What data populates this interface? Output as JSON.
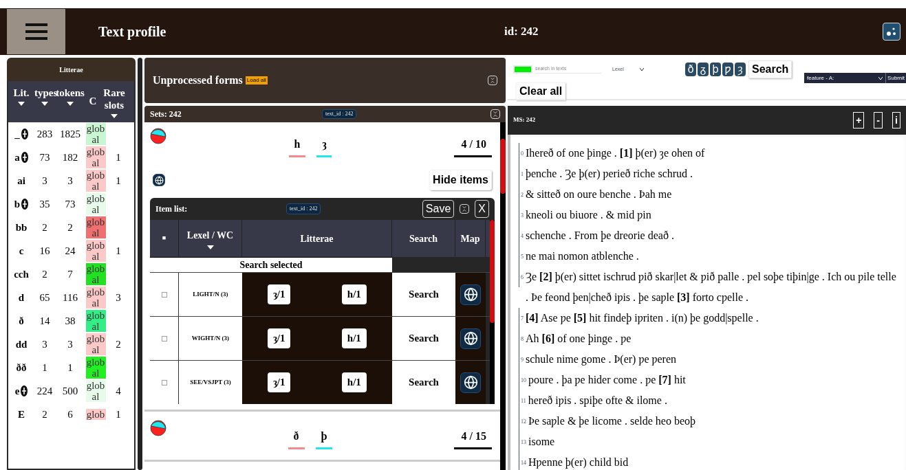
{
  "header": {
    "title": "Text profile",
    "id_label": "id: 242"
  },
  "litterae": {
    "title": "Litterae",
    "columns": [
      {
        "label": "Lit.",
        "sortable": true
      },
      {
        "label": "types",
        "sortable": true
      },
      {
        "label": "tokens",
        "sortable": true
      },
      {
        "label": "C",
        "sortable": false
      },
      {
        "label": "Rare slots",
        "sortable": true
      }
    ],
    "rows": [
      {
        "lit": "_",
        "expandable": true,
        "types": "283",
        "tokens": "1825",
        "c": "global",
        "color": "#c8f5d2"
      },
      {
        "lit": "a",
        "expandable": true,
        "types": "73",
        "tokens": "182",
        "c": "global",
        "color": "#fcc8c8",
        "rare": "1"
      },
      {
        "lit": "ai",
        "expandable": false,
        "types": "3",
        "tokens": "3",
        "c": "global",
        "color": "#fcc8c8",
        "rare": "1"
      },
      {
        "lit": "b",
        "expandable": true,
        "types": "35",
        "tokens": "73",
        "c": "global",
        "color": "#e8fbea"
      },
      {
        "lit": "bb",
        "expandable": false,
        "types": "2",
        "tokens": "2",
        "c": "global",
        "color": "#f07070"
      },
      {
        "lit": "c",
        "expandable": false,
        "types": "16",
        "tokens": "24",
        "c": "global",
        "color": "#fcc8c8",
        "rare": "1"
      },
      {
        "lit": "cch",
        "expandable": false,
        "types": "2",
        "tokens": "7",
        "c": "global",
        "color": "#22e022"
      },
      {
        "lit": "d",
        "expandable": false,
        "types": "65",
        "tokens": "116",
        "c": "global",
        "color": "#fcc8c8",
        "rare": "3"
      },
      {
        "lit": "ð",
        "expandable": false,
        "types": "14",
        "tokens": "38",
        "c": "global",
        "color": "#33ee88"
      },
      {
        "lit": "dd",
        "expandable": false,
        "types": "3",
        "tokens": "3",
        "c": "global",
        "color": "#fcc8c8",
        "rare": "2"
      },
      {
        "lit": "ðð",
        "expandable": false,
        "types": "1",
        "tokens": "1",
        "c": "global",
        "color": "#22ee22"
      },
      {
        "lit": "e",
        "expandable": true,
        "types": "224",
        "tokens": "500",
        "c": "global",
        "color": "#e8fbea",
        "rare": "4"
      },
      {
        "lit": "E",
        "expandable": false,
        "types": "2",
        "tokens": "6",
        "c": "glob",
        "color": "#fcc8c8",
        "rare": "1"
      }
    ]
  },
  "unprocessed": {
    "title": "Unprocessed forms",
    "load_button": "Load all"
  },
  "sets": {
    "title": "Sets: 242",
    "badge": "text_id : 242",
    "items": [
      {
        "letters": [
          {
            "char": "h",
            "color": "#f28b8b"
          },
          {
            "char": "ȝ",
            "color": "#22e5ee"
          }
        ],
        "count": "4 / 10",
        "hide_button": "Hide items",
        "item_list": {
          "title": "Item list:",
          "badge": "text_id : 242",
          "save": "Save",
          "close": "X",
          "columns": [
            {
              "label": "■",
              "sortable": false
            },
            {
              "label": "Lexel / WC",
              "sortable": true
            },
            {
              "label": "Litterae",
              "sortable": false
            },
            {
              "label": "Search",
              "sortable": false
            },
            {
              "label": "Map",
              "sortable": false
            }
          ],
          "search_selected": "Search selected",
          "rows": [
            {
              "lexel": "LIGHT/N (3)",
              "checked": false,
              "litterae": [
                "ȝ/1",
                "h/1"
              ],
              "search": "Search"
            },
            {
              "lexel": "WIGHT/N (3)",
              "checked": false,
              "litterae": [
                "ȝ/1",
                "h/1"
              ],
              "search": "Search"
            },
            {
              "lexel": "SEE/VSJPT (3)",
              "checked": false,
              "litterae": [
                "ȝ/1",
                "h/1"
              ],
              "search": "Search"
            }
          ]
        }
      },
      {
        "letters": [
          {
            "char": "ð",
            "color": "#f28b8b"
          },
          {
            "char": "þ",
            "color": "#22e5ee"
          }
        ],
        "count": "4 / 15"
      }
    ]
  },
  "search_bar": {
    "color": "#00ee00",
    "placeholder": "search in texts",
    "select": "Lexel",
    "chars": [
      "ð",
      "ᵹ",
      "þ",
      "ƿ",
      "ȝ"
    ],
    "search_button": "Search",
    "clear_button": "Clear all",
    "feature_select": "feature - A:",
    "submit": "Submit"
  },
  "ms": {
    "title": "MS: 242",
    "buttons": [
      "+",
      "-",
      "i"
    ],
    "lines": [
      {
        "num": "0",
        "text": "Ihereð of one þinge . **[1]** þ(er) ȝe ohen of"
      },
      {
        "num": "1",
        "text": "þenche . Ȝe þ(er) ƿerieð riche schrud ."
      },
      {
        "num": "2",
        "text": "& sitteð on oure benche . Þah me"
      },
      {
        "num": "3",
        "text": "kneoli ou biuore . & mid ƿin"
      },
      {
        "num": "4",
        "text": "schenche . From þe dreorie deað ."
      },
      {
        "num": "5",
        "text": "ne mai nomon atblenche ."
      },
      {
        "num": "6",
        "text": "Ȝe **[2]** þ(er) sittet ischrud ƿið skar|let & ƿið palle . ƿel soþe tiþin|ge . Ich ou ƿile telle . Þe feond þen|cheð iƿis . þe saƿle **[3]** forto cƿelle ."
      },
      {
        "num": "7",
        "text": "**[4]** Ase ƿe **[5]** hit findeþ iƿriten . i(n) þe godd|spelle ."
      },
      {
        "num": "8",
        "text": "Ah **[6]** of one þinge . ƿe"
      },
      {
        "num": "9",
        "text": "schule nime gome . Þ(er) ƿe ƿeren"
      },
      {
        "num": "10",
        "text": "poure . þa ƿe hider come . ƿe **[7]** hit"
      },
      {
        "num": "11",
        "text": "hereð iƿis . spiþe ofte & ilome ."
      },
      {
        "num": "12",
        "text": "Þe saƿle & þe licome . selde heo beoþ"
      },
      {
        "num": "13",
        "text": "isome"
      },
      {
        "num": "14",
        "text": "Hƿenne þ(er) child bid"
      }
    ]
  }
}
